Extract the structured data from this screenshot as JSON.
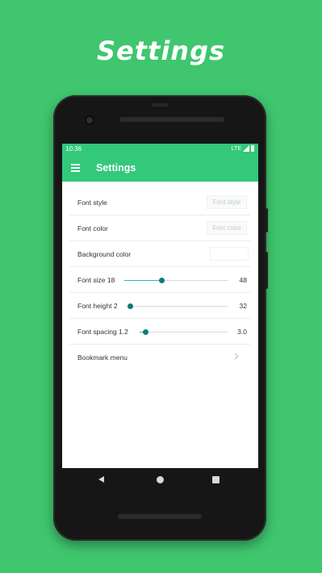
{
  "promo": {
    "title": "Settings"
  },
  "status_bar": {
    "time": "10:36",
    "network": "LTE",
    "icons": [
      "signal-icon",
      "battery-icon"
    ]
  },
  "toolbar": {
    "title": "Settings",
    "menu_icon": "hamburger-menu-icon"
  },
  "settings": {
    "font_style": {
      "label": "Font style",
      "value": "Font style"
    },
    "font_color": {
      "label": "Font color",
      "value": "Font color"
    },
    "background_color": {
      "label": "Background color",
      "value": "#ffffff"
    },
    "font_size": {
      "label": "Font size 18",
      "max": "48",
      "level": 0.36
    },
    "font_height": {
      "label": "Font height 2",
      "max": "32",
      "level": 0.0
    },
    "font_spacing": {
      "label": "Font spacing 1.2",
      "max": "3.0",
      "level": 0.07
    },
    "bookmark_menu": {
      "label": "Bookmark menu",
      "icon": "chevron-right-icon"
    }
  },
  "nav_bar": {
    "icons": [
      "back-icon",
      "home-icon",
      "recents-icon"
    ]
  },
  "colors": {
    "background": "#3fc66e",
    "app_bar": "#33c87a",
    "slider_thumb": "#0b7d72",
    "slider_fill": "#2bb9b3"
  }
}
